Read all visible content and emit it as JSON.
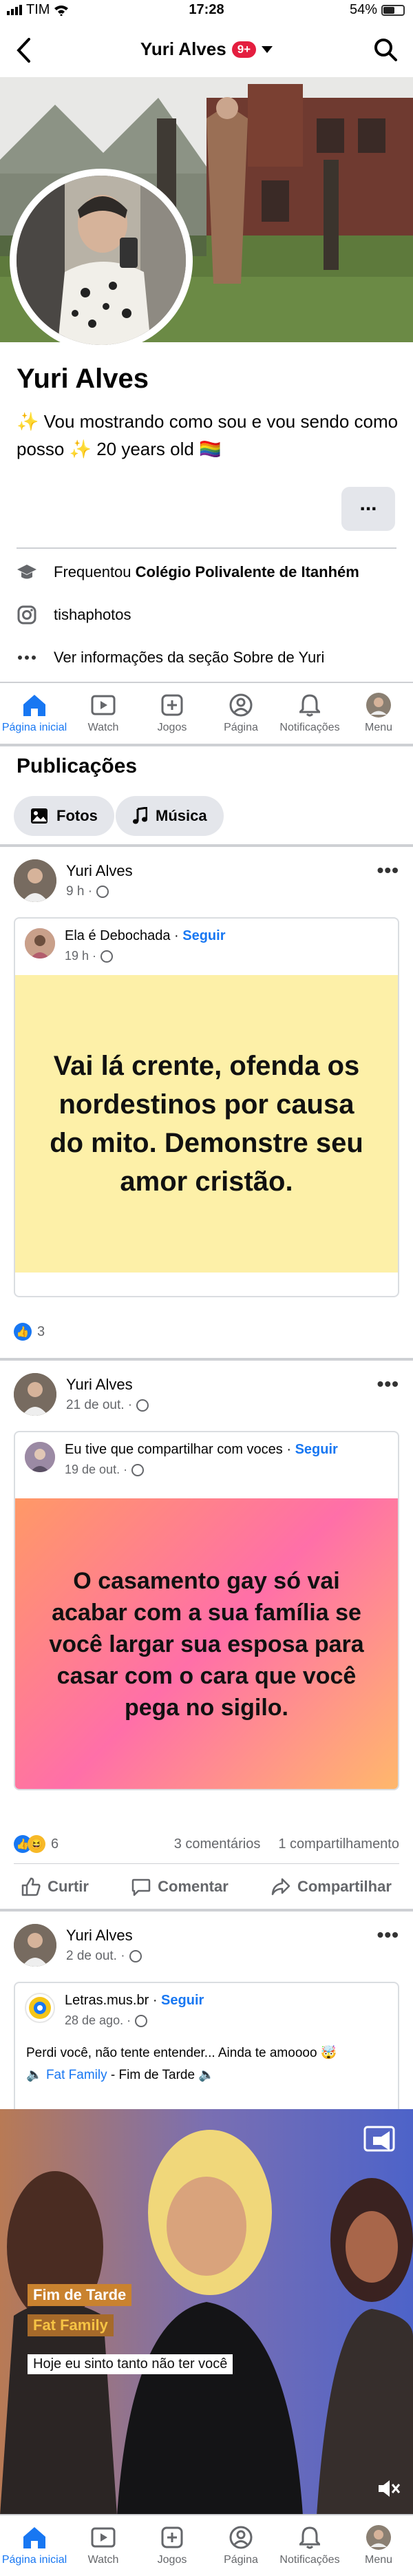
{
  "status_bar": {
    "carrier": "TIM",
    "time": "17:28",
    "battery": "54%",
    "battery_level": 0.54
  },
  "header": {
    "title": "Yuri Alves",
    "badge": "9+"
  },
  "profile": {
    "name": "Yuri Alves",
    "bio": "✨ Vou mostrando como sou e vou sendo como posso ✨ 20 years old 🏳️‍🌈",
    "more_label": "...",
    "education_prefix": "Frequentou ",
    "education_school": "Colégio Polivalente de Itanhém",
    "instagram": "tishaphotos",
    "about_link": "Ver informações da seção Sobre de Yuri"
  },
  "nav": {
    "items": [
      {
        "label": "Página inicial",
        "icon": "home-icon"
      },
      {
        "label": "Watch",
        "icon": "watch-icon"
      },
      {
        "label": "Jogos",
        "icon": "games-icon"
      },
      {
        "label": "Página",
        "icon": "page-icon"
      },
      {
        "label": "Notificações",
        "icon": "bell-icon"
      },
      {
        "label": "Menu",
        "icon": "menu-avatar-icon"
      }
    ]
  },
  "publications": {
    "title": "Publicações",
    "photos_label": "Fotos",
    "music_label": "Música"
  },
  "posts": [
    {
      "author": "Yuri Alves",
      "time": "9 h ·",
      "shared_author": "Ela é Debochada",
      "shared_follow": "Seguir",
      "shared_time": "19 h ·",
      "text": "Vai lá crente, ofenda os nordestinos por causa do mito. Demonstre seu amor cristão.",
      "reactions_count": "3"
    },
    {
      "author": "Yuri Alves",
      "time": "21 de out. ·",
      "shared_author": "Eu tive que compartilhar com voces",
      "shared_follow": "Seguir",
      "shared_time": "19 de out. ·",
      "text": "O casamento gay só vai acabar com a sua família se você largar sua esposa para casar com o cara que você pega no sigilo.",
      "reactions_count": "6",
      "comments": "3 comentários",
      "shares": "1 compartilhamento",
      "like_label": "Curtir",
      "comment_label": "Comentar",
      "share_label": "Compartilhar"
    },
    {
      "author": "Yuri Alves",
      "time": "2 de out. ·",
      "shared_author": "Letras.mus.br",
      "shared_follow": "Seguir",
      "shared_time": "28 de ago. ·",
      "text": "Perdi você, não tente entender... Ainda te amoooo 🤯",
      "link_band": "Fat Family",
      "link_song": " - Fim de Tarde 🔈",
      "video_tag1": "Fim de Tarde",
      "video_tag2": "Fat Family",
      "video_caption": "Hoje eu sinto tanto não ter você"
    }
  ],
  "colors": {
    "accent": "#1877f2",
    "badge": "#e41e3f",
    "quote1_bg": "#fdf0a8"
  }
}
